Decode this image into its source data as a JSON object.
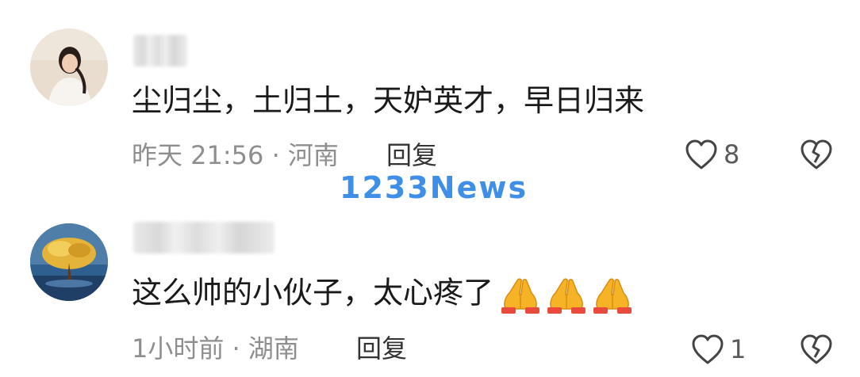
{
  "comments": [
    {
      "text": "尘归尘，土归土，天妒英才，早日归来",
      "time": "昨天 21:56 · 河南",
      "reply_label": "回复",
      "like_count": "8",
      "avatar_icon": "avatar-woman-photo"
    },
    {
      "text": "这么帅的小伙子，太心疼了",
      "time": "1小时前 · 湖南",
      "reply_label": "回复",
      "like_count": "1",
      "avatar_icon": "avatar-golden-tree",
      "emojis": [
        "folded-hands-icon",
        "folded-hands-icon",
        "folded-hands-icon"
      ]
    }
  ],
  "watermark": "1233News",
  "colors": {
    "text": "#1a1a1a",
    "meta": "#8e8e8e",
    "watermark": "#3f8fe8",
    "icon_stroke": "#444444"
  }
}
